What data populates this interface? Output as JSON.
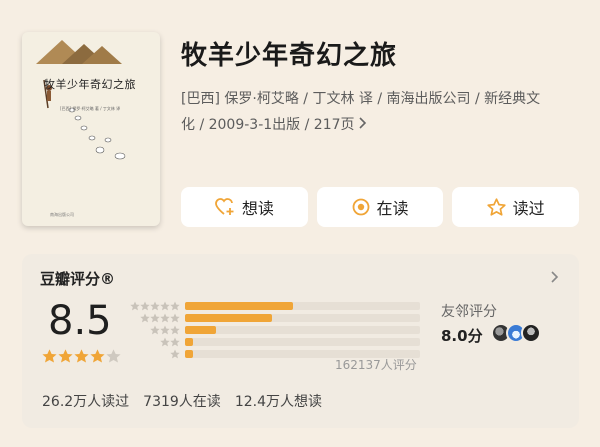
{
  "book": {
    "title": "牧羊少年奇幻之旅",
    "meta_line1": "[巴西] 保罗·柯艾略 / 丁文林 译 / 南海出版公司 / 新经典文",
    "meta_line2": "化 / 2009-3-1出版 / 217页",
    "cover": {
      "title": "牧羊少年奇幻之旅",
      "subtitle": "[巴西] 保罗·柯艾略 著 / 丁文林 译",
      "publisher": "南海出版公司"
    }
  },
  "actions": {
    "want": {
      "label": "想读",
      "icon": "heart-plus-icon"
    },
    "reading": {
      "label": "在读",
      "icon": "target-circle-icon"
    },
    "read": {
      "label": "读过",
      "icon": "star-outline-icon"
    }
  },
  "rating": {
    "label": "豆瓣评分®",
    "score": "8.5",
    "stars": 4,
    "distribution": [
      {
        "stars": 5,
        "fraction": 0.46
      },
      {
        "stars": 4,
        "fraction": 0.37
      },
      {
        "stars": 3,
        "fraction": 0.13
      },
      {
        "stars": 2,
        "fraction": 0.03
      },
      {
        "stars": 1,
        "fraction": 0.03
      }
    ],
    "raters": "162137人评分",
    "friend_label": "友邻评分",
    "friend_score": "8.0分"
  },
  "stats": {
    "read": "26.2万人读过",
    "reading": "7319人在读",
    "want": "12.4万人想读"
  },
  "colors": {
    "background": "#f6eee3",
    "accent": "#f0a537",
    "card": "#f1ebe2"
  }
}
